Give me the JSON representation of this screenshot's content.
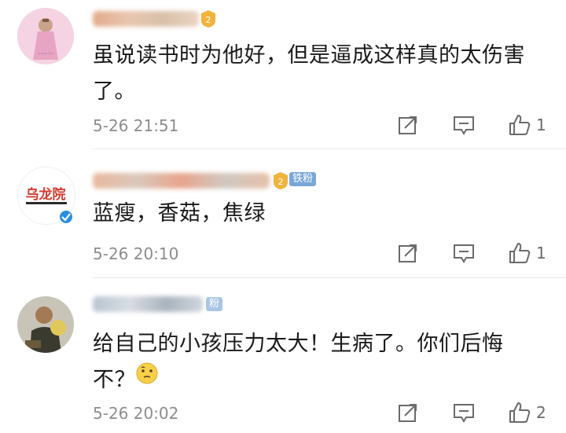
{
  "comments": [
    {
      "text": "虽说读书时为他好，但是逼成这样真的太伤害了。",
      "time": "5-26 21:51",
      "likes": "1",
      "fan_badge": ""
    },
    {
      "text": "蓝瘦，香菇，焦绿",
      "time": "5-26 20:10",
      "likes": "1",
      "fan_badge": "铁粉",
      "avatar_text": "乌龙院"
    },
    {
      "text": "给自己的小孩压力太大！生病了。你们后悔不？",
      "time": "5-26 20:02",
      "likes": "2",
      "fan_badge": "粉"
    }
  ],
  "icons": {
    "share": "share-icon",
    "reply": "comment-icon",
    "like": "thumbs-up-icon",
    "emoji": "thinking-face-emoji"
  },
  "colors": {
    "text": "#1a1a1a",
    "meta": "#8c8c8c",
    "badge": "#7aa8d6",
    "level_badge": "#f0b43c"
  }
}
